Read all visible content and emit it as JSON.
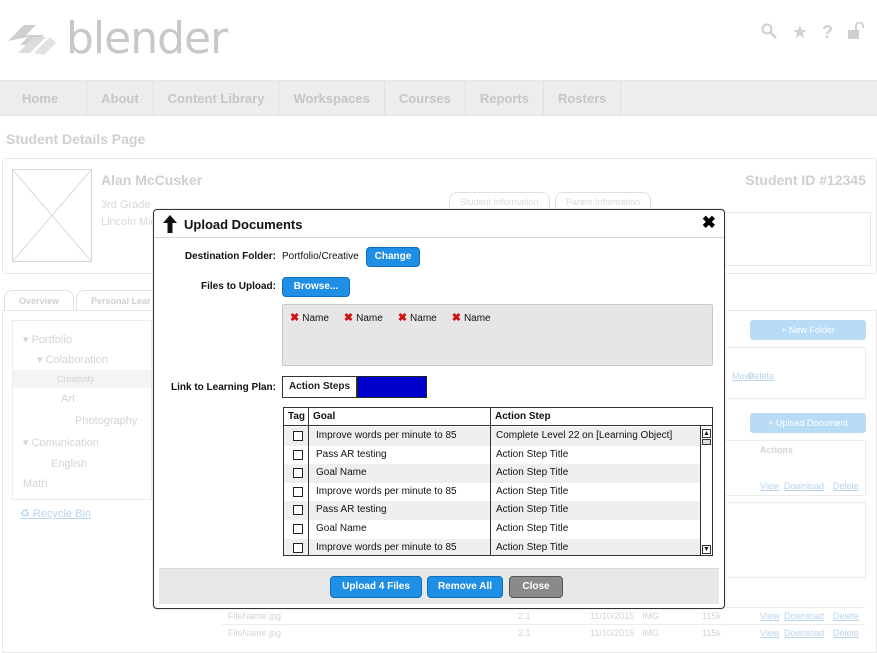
{
  "brand": {
    "name": "blender"
  },
  "top_icons": [
    "search-icon",
    "star-icon",
    "help-icon",
    "lock-icon"
  ],
  "nav": [
    "Home",
    "About",
    "Content Library",
    "Workspaces",
    "Courses",
    "Reports",
    "Rosters"
  ],
  "page_title": "Student Details Page",
  "student": {
    "name": "Alan McCusker",
    "grade": "3rd Grade",
    "school": "Lincoln Mid",
    "id": "Student ID #12345",
    "tabs": [
      "Student Information",
      "Parent Information"
    ]
  },
  "lower_tabs": [
    "Overview",
    "Personal Lear"
  ],
  "tree": {
    "items": [
      "Portfolio",
      "Colaboration",
      "Creativity",
      "Art",
      "Photography",
      "Comunication",
      "English",
      "Math"
    ],
    "recycle": "Recycle Bin"
  },
  "background": {
    "new_folder": "+ New Folder",
    "upload_document": "+ Upload Document",
    "actions_header": "Actions",
    "links": [
      "Move",
      "Delete",
      "View",
      "Download",
      "Delete"
    ],
    "files": [
      {
        "name": "FileName.jpg",
        "ver": "2.1",
        "date": "11/10/2015",
        "type": "IMG",
        "size": "115k"
      },
      {
        "name": "FileName.jpg",
        "ver": "2.1",
        "date": "11/10/2015",
        "type": "IMG",
        "size": "115k"
      }
    ]
  },
  "modal": {
    "title": "Upload Documents",
    "destination_label": "Destination Folder:",
    "destination_value": "Portfolio/Creative",
    "change_label": "Change",
    "files_label": "Files to Upload:",
    "browse_label": "Browse...",
    "files": [
      "Name",
      "Name",
      "Name",
      "Name"
    ],
    "link_label": "Link to Learning Plan:",
    "action_steps_tab": "Action Steps",
    "table": {
      "headers": [
        "Tag",
        "Goal",
        "Action Step"
      ],
      "rows": [
        {
          "goal": "Improve words per minute to 85",
          "step": "Complete Level 22 on [Learning Object]"
        },
        {
          "goal": "Pass AR testing",
          "step": "Action Step Title"
        },
        {
          "goal": "Goal Name",
          "step": "Action Step Title"
        },
        {
          "goal": "Improve words per minute to 85",
          "step": "Action Step Title"
        },
        {
          "goal": "Pass AR testing",
          "step": "Action Step Title"
        },
        {
          "goal": "Goal Name",
          "step": "Action Step Title"
        },
        {
          "goal": "Improve words per minute to 85",
          "step": "Action Step Title"
        }
      ]
    },
    "footer": {
      "upload": "Upload 4 Files",
      "remove": "Remove All",
      "close": "Close"
    }
  },
  "colors": {
    "accent": "#1f8fe6",
    "action_block": "#0000cc",
    "remove_x": "#d01010"
  }
}
